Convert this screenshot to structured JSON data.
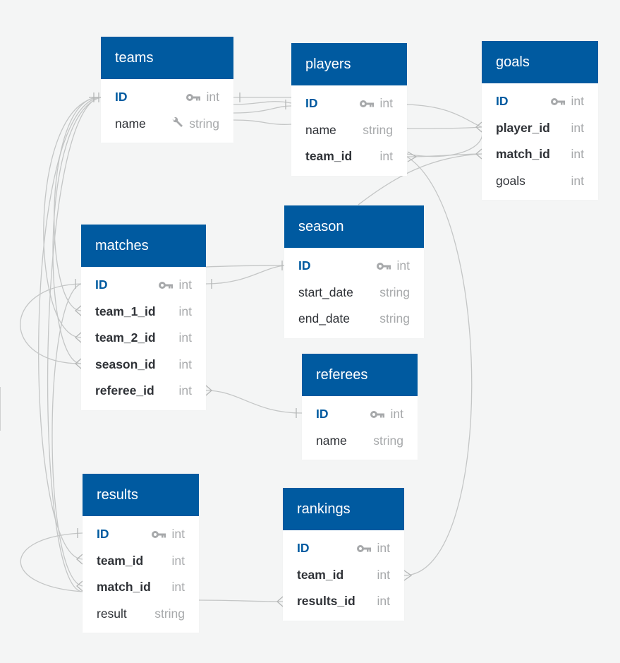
{
  "tables": [
    {
      "name": "teams",
      "fields": [
        {
          "name": "ID",
          "type": "int",
          "icon": "key-icon",
          "kind": "pk"
        },
        {
          "name": "name",
          "type": "string",
          "icon": "wrench-icon",
          "kind": "normal"
        }
      ]
    },
    {
      "name": "players",
      "fields": [
        {
          "name": "ID",
          "type": "int",
          "icon": "key-icon",
          "kind": "pk"
        },
        {
          "name": "name",
          "type": "string",
          "icon": "",
          "kind": "normal"
        },
        {
          "name": "team_id",
          "type": "int",
          "icon": "",
          "kind": "fk"
        }
      ]
    },
    {
      "name": "goals",
      "fields": [
        {
          "name": "ID",
          "type": "int",
          "icon": "key-icon",
          "kind": "pk"
        },
        {
          "name": "player_id",
          "type": "int",
          "icon": "",
          "kind": "fk"
        },
        {
          "name": "match_id",
          "type": "int",
          "icon": "",
          "kind": "fk"
        },
        {
          "name": "goals",
          "type": "int",
          "icon": "",
          "kind": "normal"
        }
      ]
    },
    {
      "name": "matches",
      "fields": [
        {
          "name": "ID",
          "type": "int",
          "icon": "key-icon",
          "kind": "pk"
        },
        {
          "name": "team_1_id",
          "type": "int",
          "icon": "",
          "kind": "fk"
        },
        {
          "name": "team_2_id",
          "type": "int",
          "icon": "",
          "kind": "fk"
        },
        {
          "name": "season_id",
          "type": "int",
          "icon": "",
          "kind": "fk"
        },
        {
          "name": "referee_id",
          "type": "int",
          "icon": "",
          "kind": "fk"
        }
      ]
    },
    {
      "name": "season",
      "fields": [
        {
          "name": "ID",
          "type": "int",
          "icon": "key-icon",
          "kind": "pk"
        },
        {
          "name": "start_date",
          "type": "string",
          "icon": "",
          "kind": "normal"
        },
        {
          "name": "end_date",
          "type": "string",
          "icon": "",
          "kind": "normal"
        }
      ]
    },
    {
      "name": "referees",
      "fields": [
        {
          "name": "ID",
          "type": "int",
          "icon": "key-icon",
          "kind": "pk"
        },
        {
          "name": "name",
          "type": "string",
          "icon": "",
          "kind": "normal"
        }
      ]
    },
    {
      "name": "results",
      "fields": [
        {
          "name": "ID",
          "type": "int",
          "icon": "key-icon",
          "kind": "pk"
        },
        {
          "name": "team_id",
          "type": "int",
          "icon": "",
          "kind": "fk"
        },
        {
          "name": "match_id",
          "type": "int",
          "icon": "",
          "kind": "fk"
        },
        {
          "name": "result",
          "type": "string",
          "icon": "",
          "kind": "normal"
        }
      ]
    },
    {
      "name": "rankings",
      "fields": [
        {
          "name": "ID",
          "type": "int",
          "icon": "key-icon",
          "kind": "pk"
        },
        {
          "name": "team_id",
          "type": "int",
          "icon": "",
          "kind": "fk"
        },
        {
          "name": "results_id",
          "type": "int",
          "icon": "",
          "kind": "fk"
        }
      ]
    }
  ],
  "relationships": [
    {
      "from": "players.team_id",
      "to": "teams.ID",
      "cardinality": "many-to-one"
    },
    {
      "from": "goals.player_id",
      "to": "players.ID",
      "cardinality": "many-to-one"
    },
    {
      "from": "goals.match_id",
      "to": "matches.ID",
      "cardinality": "many-to-one"
    },
    {
      "from": "matches.team_1_id",
      "to": "teams.ID",
      "cardinality": "many-to-one"
    },
    {
      "from": "matches.team_2_id",
      "to": "teams.ID",
      "cardinality": "many-to-one"
    },
    {
      "from": "matches.season_id",
      "to": "season.ID",
      "cardinality": "many-to-one"
    },
    {
      "from": "matches.referee_id",
      "to": "referees.ID",
      "cardinality": "many-to-one"
    },
    {
      "from": "results.team_id",
      "to": "teams.ID",
      "cardinality": "many-to-one"
    },
    {
      "from": "results.match_id",
      "to": "matches.ID",
      "cardinality": "many-to-one"
    },
    {
      "from": "rankings.team_id",
      "to": "teams.ID",
      "cardinality": "many-to-one"
    },
    {
      "from": "rankings.results_id",
      "to": "results.ID",
      "cardinality": "many-to-one"
    }
  ],
  "colors": {
    "header": "#005aa0",
    "pk_text": "#005aa0",
    "type_text": "#a7a9ab",
    "line": "#c4c6c6",
    "background": "#f4f5f5"
  }
}
